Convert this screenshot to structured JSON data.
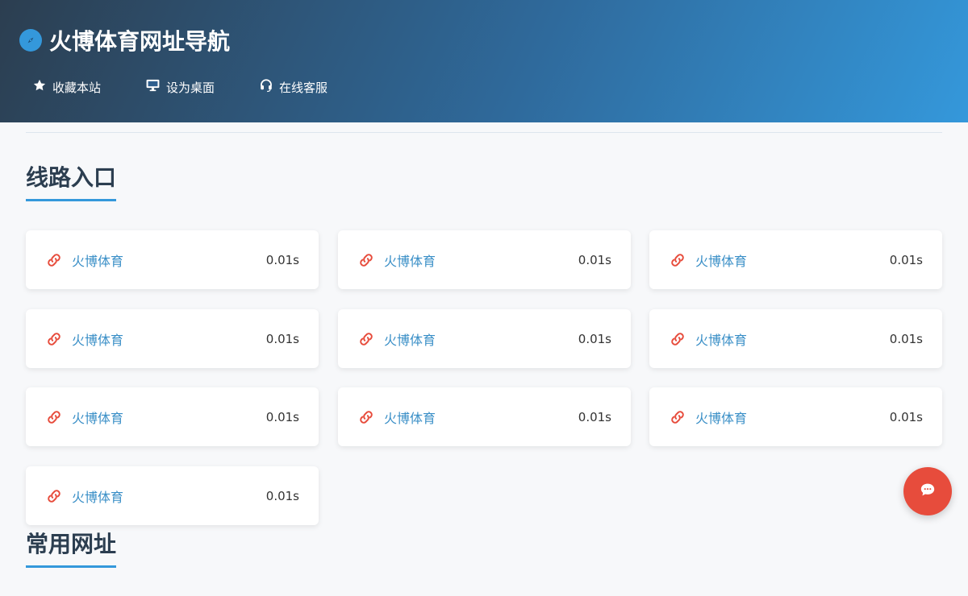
{
  "header": {
    "title": "火博体育网址导航",
    "brand_icon": "compass-icon",
    "gradient_colors": [
      "#2c3e50",
      "#3498db"
    ],
    "nav": [
      {
        "label": "收藏本站",
        "icon": "star-icon"
      },
      {
        "label": "设为桌面",
        "icon": "desktop-icon"
      },
      {
        "label": "在线客服",
        "icon": "headset-icon"
      }
    ]
  },
  "sections": [
    {
      "title": "线路入口",
      "cards": [
        {
          "name": "火博体育",
          "latency": "0.01s"
        },
        {
          "name": "火博体育",
          "latency": "0.01s"
        },
        {
          "name": "火博体育",
          "latency": "0.01s"
        },
        {
          "name": "火博体育",
          "latency": "0.01s"
        },
        {
          "name": "火博体育",
          "latency": "0.01s"
        },
        {
          "name": "火博体育",
          "latency": "0.01s"
        },
        {
          "name": "火博体育",
          "latency": "0.01s"
        },
        {
          "name": "火博体育",
          "latency": "0.01s"
        },
        {
          "name": "火博体育",
          "latency": "0.01s"
        },
        {
          "name": "火博体育",
          "latency": "0.01s"
        }
      ]
    },
    {
      "title": "常用网址",
      "cards": []
    }
  ],
  "chat_button": {
    "icon": "chat-icon",
    "color": "#e74c3c"
  },
  "colors": {
    "accent": "#3498db",
    "link_text": "#3a8fc7",
    "link_icon": "#e74c3c",
    "heading": "#2c3e50"
  }
}
